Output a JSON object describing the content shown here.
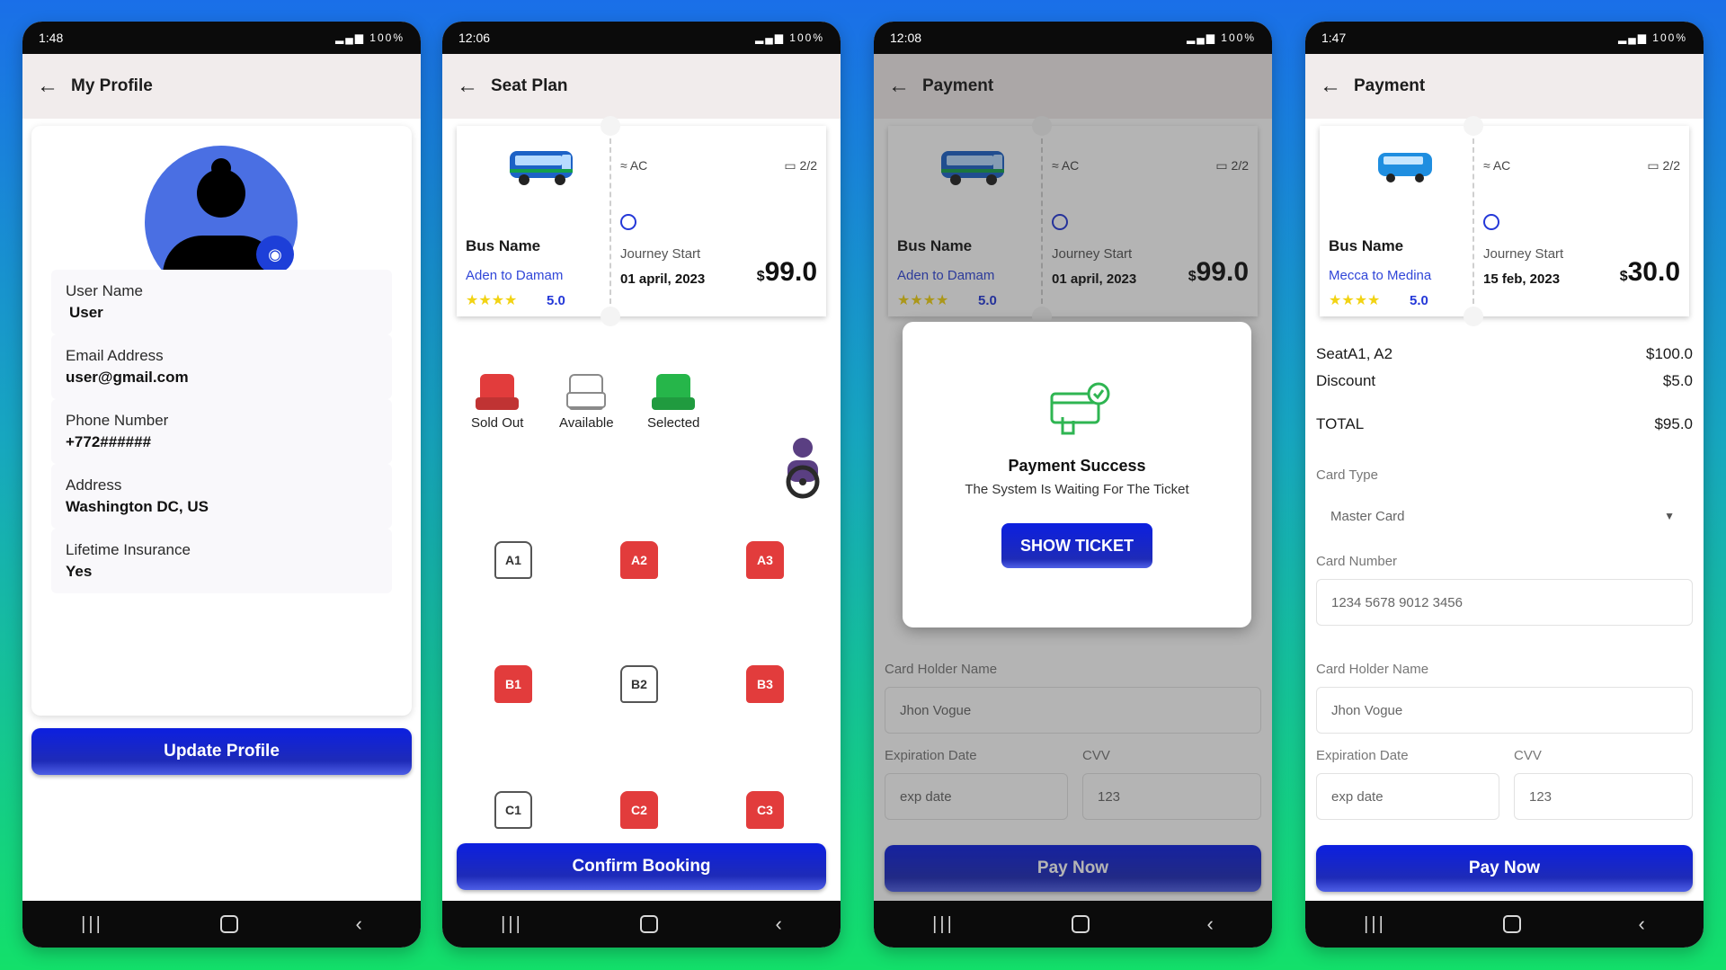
{
  "status_times": [
    "1:48",
    "12:06",
    "12:08",
    "1:47"
  ],
  "status_right": "100%",
  "profile": {
    "title": "My Profile",
    "fields": [
      {
        "label": "User Name",
        "value": "User"
      },
      {
        "label": "Email Address",
        "value": "user@gmail.com"
      },
      {
        "label": "Phone Number",
        "value": "+772######"
      },
      {
        "label": "Address",
        "value": "Washington DC, US"
      },
      {
        "label": "Lifetime Insurance",
        "value": "Yes"
      }
    ],
    "button": "Update Profile"
  },
  "seat_plan": {
    "title": "Seat Plan",
    "ticket": {
      "bus_name": "Bus Name",
      "route": "Aden to Damam",
      "stars": "★★★★",
      "rating": "5.0",
      "ac": "AC",
      "seats": "2/2",
      "journey_label": "Journey Start",
      "date": "01 april, 2023",
      "currency": "$",
      "price": "99.0"
    },
    "legend": [
      {
        "label": "Sold Out",
        "state": "sold"
      },
      {
        "label": "Available",
        "state": "avail"
      },
      {
        "label": "Selected",
        "state": "sel"
      }
    ],
    "seats": [
      {
        "id": "A1",
        "state": "avail"
      },
      {
        "id": "A2",
        "state": "sold"
      },
      {
        "id": "A3",
        "state": "sold"
      },
      {
        "id": "B1",
        "state": "sold"
      },
      {
        "id": "B2",
        "state": "avail"
      },
      {
        "id": "B3",
        "state": "sold"
      },
      {
        "id": "C1",
        "state": "avail"
      },
      {
        "id": "C2",
        "state": "sold"
      },
      {
        "id": "C3",
        "state": "sold"
      }
    ],
    "button": "Confirm Booking"
  },
  "payment_modal": {
    "title": "Payment",
    "ticket": {
      "bus_name": "Bus Name",
      "route": "Aden to Damam",
      "stars": "★★★★",
      "rating": "5.0",
      "ac": "AC",
      "seats": "2/2",
      "journey_label": "Journey Start",
      "date": "01 april, 2023",
      "currency": "$",
      "price": "99.0"
    },
    "card_holder_label": "Card Holder Name",
    "card_holder_value": "Jhon Vogue",
    "exp_label": "Expiration Date",
    "exp_placeholder": "exp date",
    "cvv_label": "CVV",
    "cvv_value": "123",
    "pay_button": "Pay Now",
    "modal_title": "Payment Success",
    "modal_sub": "The System Is Waiting For The Ticket",
    "modal_button": "SHOW TICKET"
  },
  "payment": {
    "title": "Payment",
    "ticket": {
      "bus_name": "Bus Name",
      "route": "Mecca to Medina",
      "stars": "★★★★",
      "rating": "5.0",
      "ac": "AC",
      "seats": "2/2",
      "journey_label": "Journey Start",
      "date": "15 feb, 2023",
      "currency": "$",
      "price": "30.0"
    },
    "seat_label": "SeatA1, A2",
    "seat_value": "$100.0",
    "discount_label": "Discount",
    "discount_value": "$5.0",
    "total_label": "TOTAL",
    "total_value": "$95.0",
    "card_type_label": "Card Type",
    "card_type_value": "Master Card",
    "card_number_label": "Card Number",
    "card_number_value": "1234 5678 9012 3456",
    "card_holder_label": "Card Holder Name",
    "card_holder_value": "Jhon Vogue",
    "exp_label": "Expiration Date",
    "exp_placeholder": "exp date",
    "cvv_label": "CVV",
    "cvv_value": "123",
    "pay_button": "Pay Now"
  },
  "colors": {
    "accent": "#1d2fd6",
    "sold": "#e23c3c",
    "selected": "#26b64a",
    "star": "#f2d313"
  }
}
